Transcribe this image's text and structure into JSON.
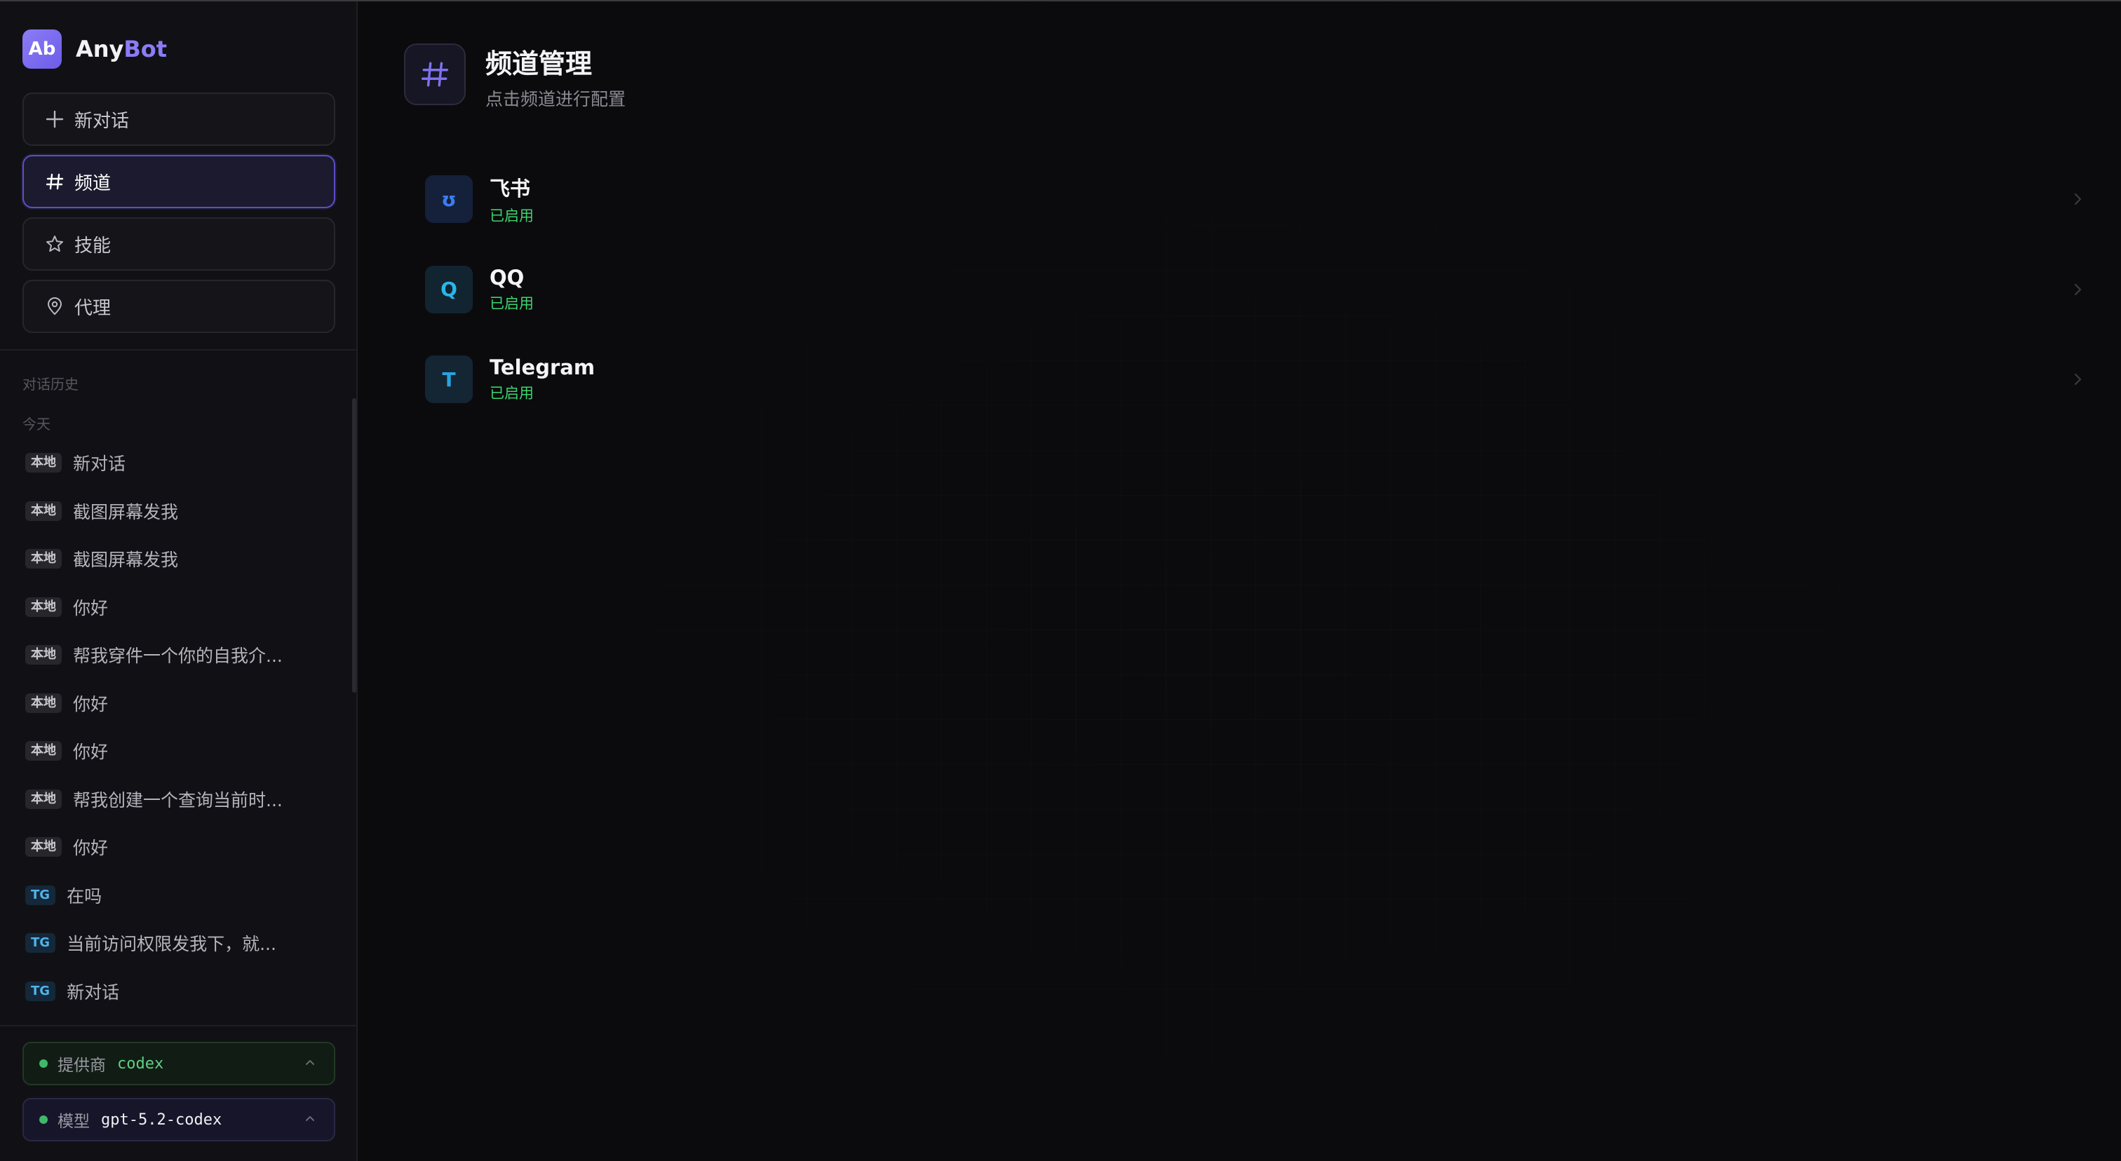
{
  "brand": {
    "logo_text": "Ab",
    "name_part1": "Any",
    "name_part2": "Bot",
    "accent_color": "#8b7cf6"
  },
  "nav": [
    {
      "label": "新对话",
      "icon": "plus-icon",
      "active": false
    },
    {
      "label": "频道",
      "icon": "hash-icon",
      "active": true
    },
    {
      "label": "技能",
      "icon": "star-icon",
      "active": false
    },
    {
      "label": "代理",
      "icon": "location-pin-icon",
      "active": false
    }
  ],
  "history": {
    "title": "对话历史",
    "group": "今天",
    "items": [
      {
        "tag": "本地",
        "label": "新对话"
      },
      {
        "tag": "本地",
        "label": "截图屏幕发我"
      },
      {
        "tag": "本地",
        "label": "截图屏幕发我"
      },
      {
        "tag": "本地",
        "label": "你好"
      },
      {
        "tag": "本地",
        "label": "帮我穿件一个你的自我介..."
      },
      {
        "tag": "本地",
        "label": "你好"
      },
      {
        "tag": "本地",
        "label": "你好"
      },
      {
        "tag": "本地",
        "label": "帮我创建一个查询当前时..."
      },
      {
        "tag": "本地",
        "label": "你好"
      },
      {
        "tag": "TG",
        "label": "在吗"
      },
      {
        "tag": "TG",
        "label": "当前访问权限发我下，就..."
      },
      {
        "tag": "TG",
        "label": "新对话"
      }
    ]
  },
  "provider": {
    "label": "提供商",
    "value": "codex",
    "status_color": "#3fb86a"
  },
  "model": {
    "label": "模型",
    "value": "gpt-5.2-codex",
    "status_color": "#3fb86a"
  },
  "page": {
    "title": "频道管理",
    "subtitle": "点击频道进行配置"
  },
  "channels": [
    {
      "name": "飞书",
      "status": "已启用",
      "icon_glyph": "ʊ",
      "icon": "feishu-icon"
    },
    {
      "name": "QQ",
      "status": "已启用",
      "icon_glyph": "Q",
      "icon": "qq-icon"
    },
    {
      "name": "Telegram",
      "status": "已启用",
      "icon_glyph": "T",
      "icon": "telegram-icon"
    }
  ]
}
